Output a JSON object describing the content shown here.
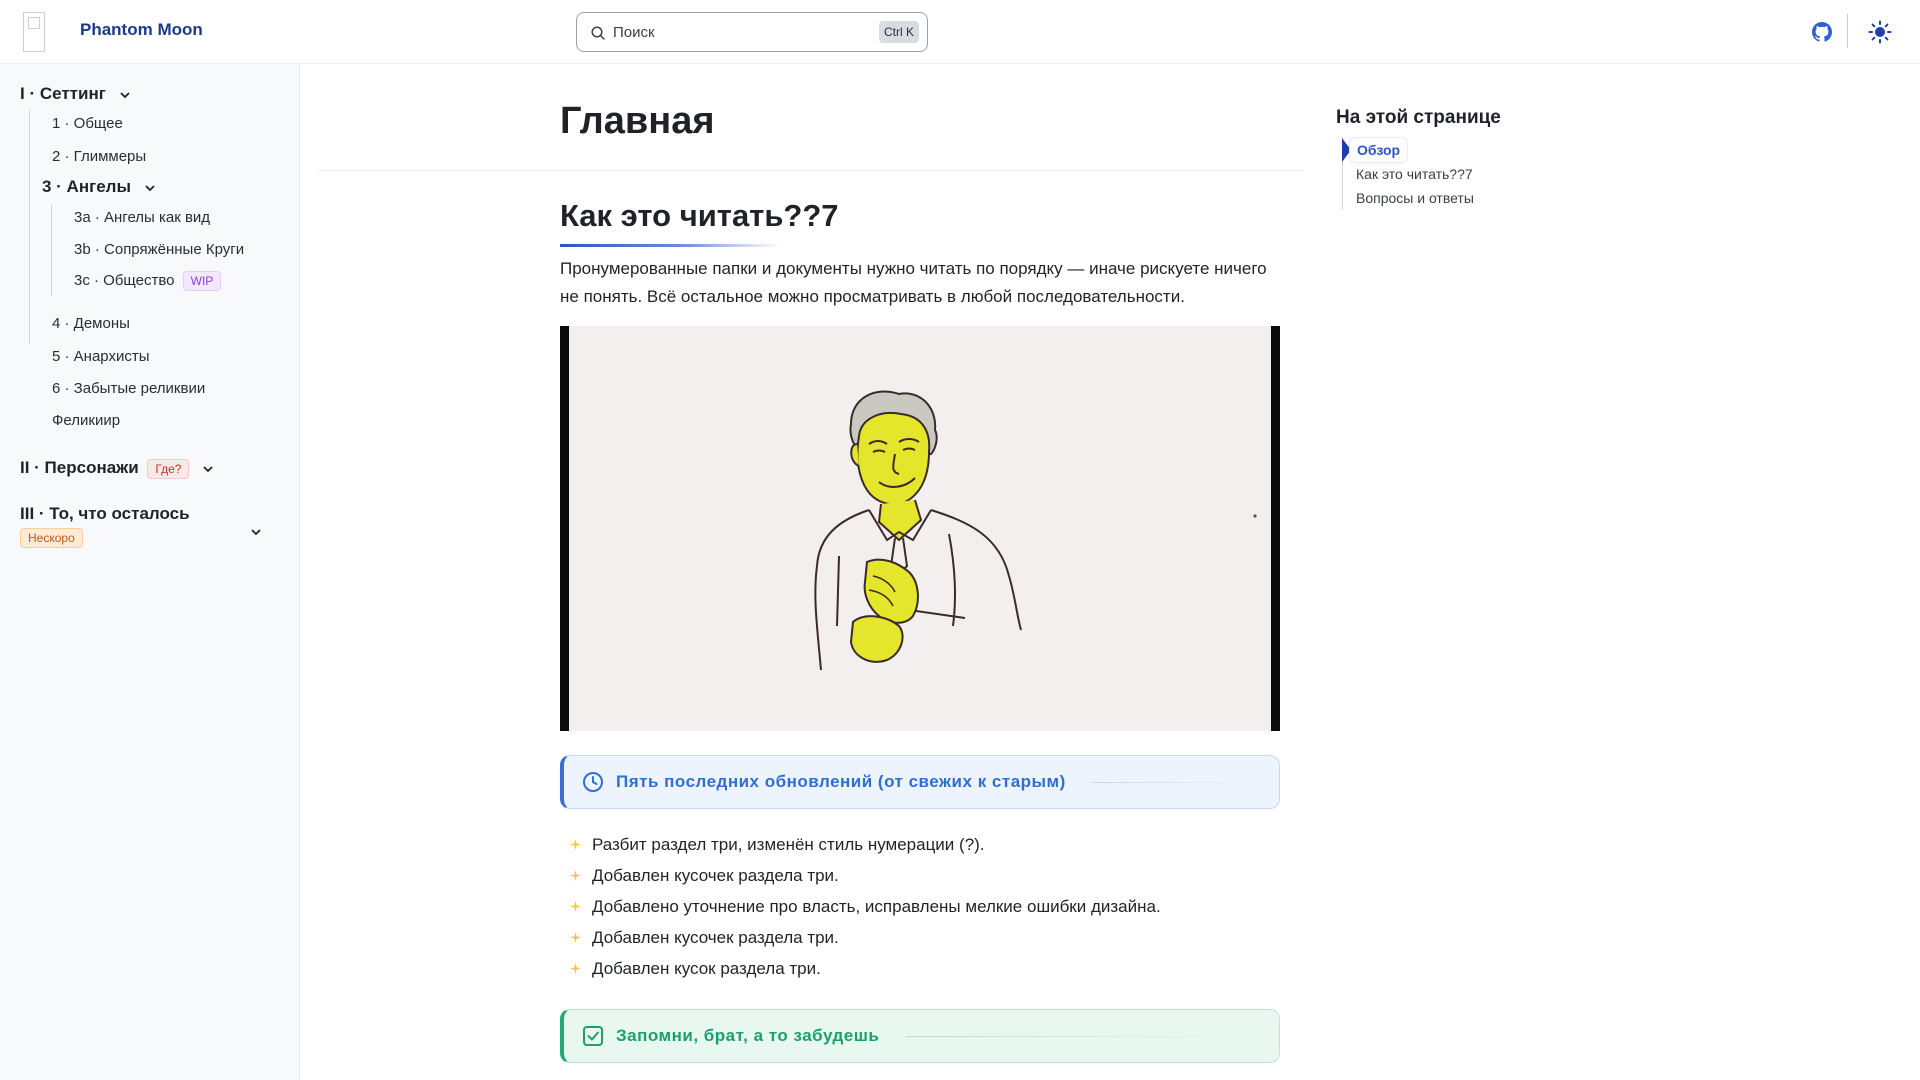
{
  "header": {
    "brand": "Phantom Moon",
    "search_placeholder": "Поиск",
    "search_shortcut": "Ctrl K"
  },
  "sidebar": {
    "section1": {
      "label": "I · Сеттинг",
      "items": [
        "1 · Общее",
        "2 · Глиммеры"
      ]
    },
    "subsection3": {
      "label": "3 · Ангелы",
      "items": [
        "3a · Ангелы как вид",
        "3b · Сопряжённые Круги",
        "3c · Общество"
      ],
      "badge": "WIP"
    },
    "section1_rest": [
      "4 · Демоны",
      "5 · Анархисты",
      "6 · Забытые реликвии",
      "Феликиир"
    ],
    "section2": {
      "label": "II · Персонажи",
      "badge": "Где?"
    },
    "section3": {
      "label": "III · То, что осталось",
      "badge": "Нескоро"
    }
  },
  "main": {
    "title": "Главная",
    "heading": "Как это читать??7",
    "intro": "Пронумерованные папки и документы нужно читать по порядку — иначе рискуете ничего не понять. Всё остальное можно просматривать в любой последовательности.",
    "updates_callout": "Пять последних обновлений (от свежих к старым)",
    "updates": [
      "Разбит раздел три, изменён стиль нумерации (?).",
      "Добавлен кусочек раздела три.",
      "Добавлено уточнение про власть, исправлены мелкие ошибки дизайна.",
      "Добавлен кусочек раздела три.",
      "Добавлен кусок раздела три."
    ],
    "remember_callout": "Запомни, брат, а то забудешь"
  },
  "toc": {
    "title": "На этой странице",
    "items": [
      "Обзор",
      "Как это читать??7",
      "Вопросы и ответы"
    ]
  },
  "colors": {
    "brand": "#1b3a8a",
    "accent_blue": "#2f6fd3",
    "accent_green": "#1aa06c",
    "figure_yellow": "#e6e619"
  }
}
